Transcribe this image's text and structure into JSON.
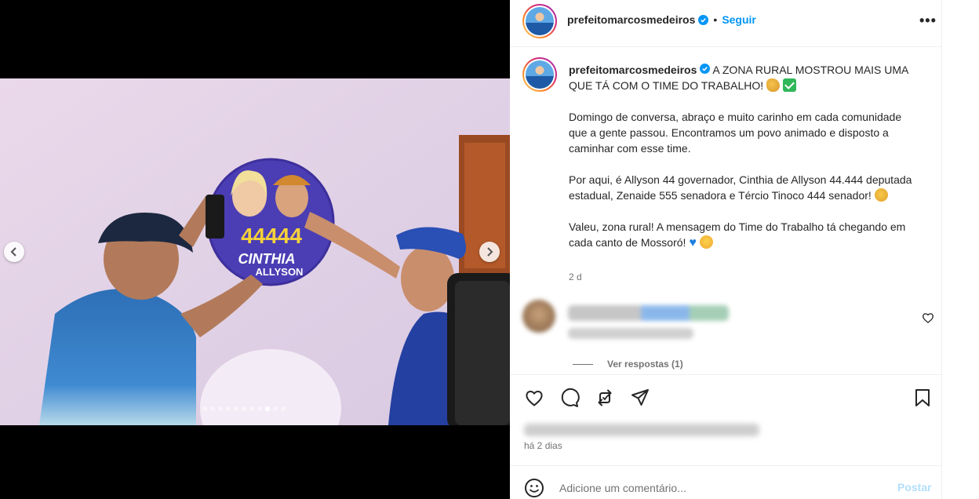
{
  "media": {
    "poster_number": "44444",
    "poster_name": "CINTHIA",
    "poster_surname": "ALLYSON",
    "carousel_total": 11,
    "carousel_active": 9
  },
  "header": {
    "username": "prefeitomarcosmedeiros",
    "separator": "•",
    "follow_label": "Seguir",
    "more_label": "•••"
  },
  "caption": {
    "username": "prefeitomarcosmedeiros",
    "paragraph_1": "A ZONA RURAL MOSTROU MAIS UMA QUE TÁ COM O TIME DO TRABALHO!",
    "paragraph_2": "Domingo de conversa, abraço e muito carinho em cada comunidade que a gente passou. Encontramos um povo animado e disposto a caminhar com esse time.",
    "paragraph_3": "Por aqui, é Allyson 44 governador, Cinthia de Allyson 44.444 deputada estadual, Zenaide 555 senadora e Tércio Tinoco 444 senador!",
    "paragraph_4": "Valeu, zona rural! A mensagem do Time do Trabalho tá chegando em cada canto de Mossoró!",
    "time_short": "2 d",
    "emoji_1": "muscle-emoji",
    "emoji_2": "check-emoji",
    "emoji_3": "clap-emoji",
    "emoji_4": "blue-heart-emoji",
    "emoji_5": "heart-eyes-emoji"
  },
  "comment": {
    "view_replies": "Ver respostas (1)"
  },
  "footer": {
    "posted_ago": "há 2 dias",
    "comment_placeholder": "Adicione um comentário...",
    "post_label": "Postar"
  },
  "colors": {
    "accent": "#0095f6",
    "post_disabled": "#b2dffc",
    "muted": "#737373",
    "verified": "#0095f6"
  }
}
